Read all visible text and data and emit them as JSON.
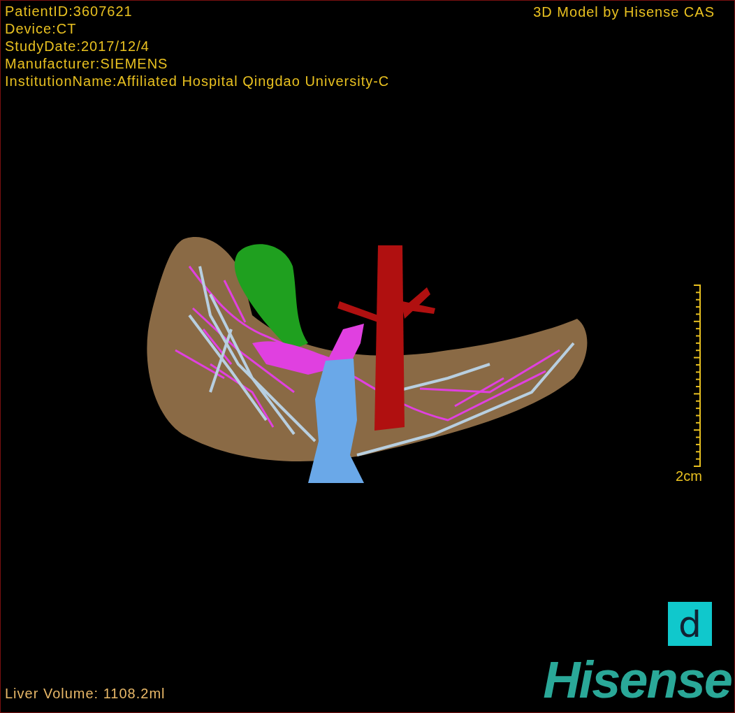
{
  "patient_info": [
    "PatientID:3607621",
    "Device:CT",
    "StudyDate:2017/12/4",
    "Manufacturer:SIEMENS",
    "InstitutionName:Affiliated Hospital Qingdao University-C"
  ],
  "watermark_title": "3D Model by Hisense CAS",
  "scale_bar": {
    "label": "2cm"
  },
  "measurement": "Liver Volume: 1108.2ml",
  "badge": "d",
  "logo": "Hisense"
}
